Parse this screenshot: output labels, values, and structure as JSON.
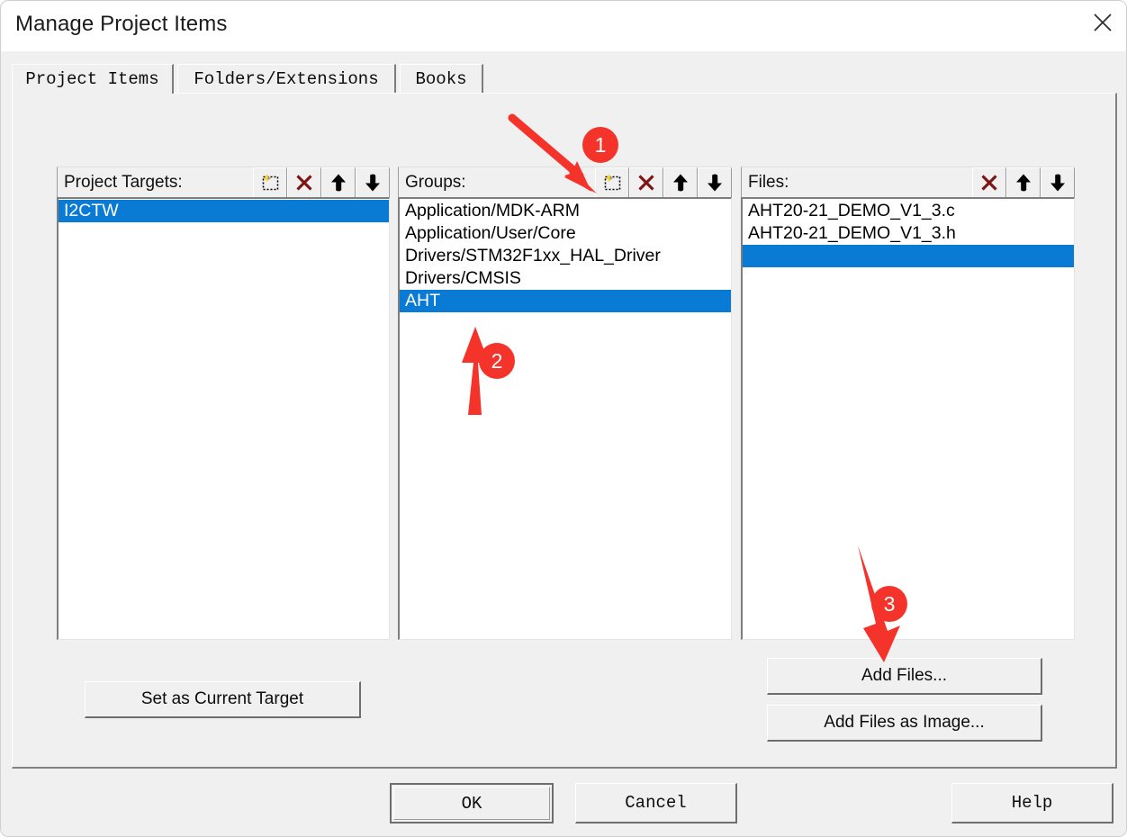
{
  "window": {
    "title": "Manage Project Items",
    "close_icon": "close-icon"
  },
  "tabs": [
    {
      "label": "Project Items",
      "active": true
    },
    {
      "label": "Folders/Extensions",
      "active": false
    },
    {
      "label": "Books",
      "active": false
    }
  ],
  "columns": {
    "targets": {
      "label": "Project Targets:",
      "tools": [
        "new-item-icon",
        "delete-x-icon",
        "move-up-icon",
        "move-down-icon"
      ],
      "items": [
        {
          "text": "I2CTW",
          "selected": true
        }
      ]
    },
    "groups": {
      "label": "Groups:",
      "tools": [
        "new-item-icon",
        "delete-x-icon",
        "move-up-icon",
        "move-down-icon"
      ],
      "items": [
        {
          "text": "Application/MDK-ARM",
          "selected": false
        },
        {
          "text": "Application/User/Core",
          "selected": false
        },
        {
          "text": "Drivers/STM32F1xx_HAL_Driver",
          "selected": false
        },
        {
          "text": "Drivers/CMSIS",
          "selected": false
        },
        {
          "text": "AHT",
          "selected": true
        }
      ]
    },
    "files": {
      "label": "Files:",
      "tools": [
        "delete-x-icon",
        "move-up-icon",
        "move-down-icon"
      ],
      "items": [
        {
          "text": "AHT20-21_DEMO_V1_3.c",
          "selected": false
        },
        {
          "text": "AHT20-21_DEMO_V1_3.h",
          "selected": false
        },
        {
          "text": "",
          "selected": true
        }
      ]
    }
  },
  "buttons": {
    "set_as_current_target": "Set as Current Target",
    "add_files": "Add Files...",
    "add_files_as_image": "Add Files as Image...",
    "ok": "OK",
    "cancel": "Cancel",
    "help": "Help"
  },
  "annotations": {
    "accent_color": "#f4342b",
    "markers": [
      {
        "number": "1",
        "target": "groups-new-item-button"
      },
      {
        "number": "2",
        "target": "groups-list-item-aht"
      },
      {
        "number": "3",
        "target": "add-files-button"
      }
    ]
  },
  "colors": {
    "selection_blue": "#0a7bd4",
    "dialog_face": "#f0f0f0",
    "delete_x_red": "#7f1414"
  }
}
